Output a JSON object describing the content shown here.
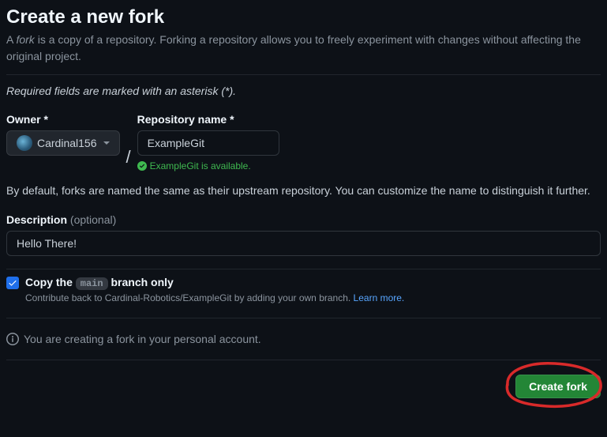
{
  "header": {
    "title": "Create a new fork",
    "subtitle_prefix": "A ",
    "subtitle_em": "fork",
    "subtitle_rest": " is a copy of a repository. Forking a repository allows you to freely experiment with changes without affecting the original project."
  },
  "required_note": "Required fields are marked with an asterisk (*).",
  "owner": {
    "label": "Owner *",
    "name": "Cardinal156"
  },
  "repo": {
    "label": "Repository name *",
    "value": "ExampleGit",
    "availability": "ExampleGit is available."
  },
  "naming_help": "By default, forks are named the same as their upstream repository. You can customize the name to distinguish it further.",
  "description": {
    "label": "Description",
    "optional": "(optional)",
    "value": "Hello There!"
  },
  "copy_branch": {
    "checked": true,
    "label_prefix": "Copy the ",
    "branch": "main",
    "label_suffix": " branch only",
    "help_prefix": "Contribute back to Cardinal-Robotics/ExampleGit by adding your own branch. ",
    "learn_more": "Learn more."
  },
  "info_note": "You are creating a fork in your personal account.",
  "submit": {
    "label": "Create fork"
  }
}
